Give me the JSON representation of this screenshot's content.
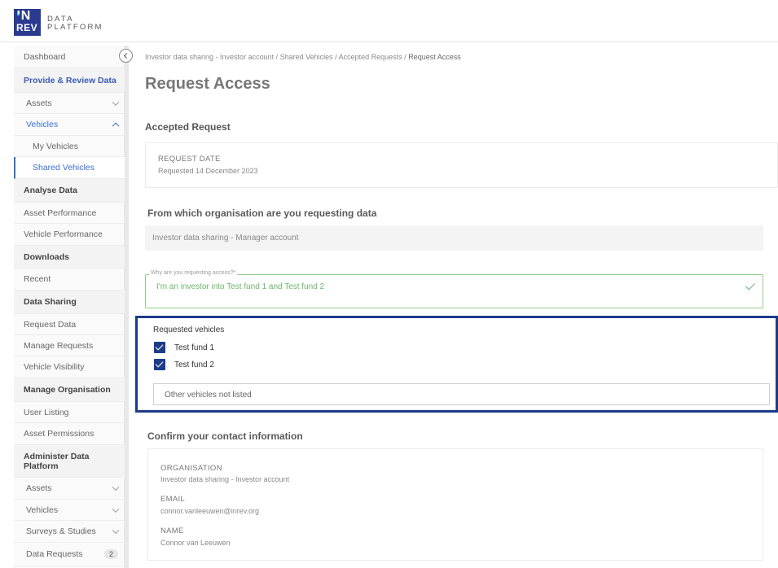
{
  "header": {
    "logo_line1": "'N",
    "logo_line2": "REV",
    "logo_text_line1": "DATA",
    "logo_text_line2": "PLATFORM"
  },
  "sidebar": {
    "items": [
      {
        "label": "Dashboard"
      },
      {
        "label": "Provide & Review Data"
      },
      {
        "label": "Assets"
      },
      {
        "label": "Vehicles"
      },
      {
        "label": "My Vehicles"
      },
      {
        "label": "Shared Vehicles"
      },
      {
        "label": "Analyse Data"
      },
      {
        "label": "Asset Performance"
      },
      {
        "label": "Vehicle Performance"
      },
      {
        "label": "Downloads"
      },
      {
        "label": "Recent"
      },
      {
        "label": "Data Sharing"
      },
      {
        "label": "Request Data"
      },
      {
        "label": "Manage Requests"
      },
      {
        "label": "Vehicle Visibility"
      },
      {
        "label": "Manage Organisation"
      },
      {
        "label": "User Listing"
      },
      {
        "label": "Asset Permissions"
      },
      {
        "label": "Administer Data Platform"
      },
      {
        "label": "Assets"
      },
      {
        "label": "Vehicles"
      },
      {
        "label": "Surveys & Studies"
      },
      {
        "label": "Data Requests",
        "badge": "2"
      }
    ]
  },
  "breadcrumb": {
    "path": "Investor data sharing - Investor account / Shared Vehicles / Accepted Requests / ",
    "current": "Request Access"
  },
  "page": {
    "title": "Request Access"
  },
  "accepted_request": {
    "title": "Accepted Request",
    "date_label": "REQUEST DATE",
    "date_value": "Requested 14 December 2023"
  },
  "organisation": {
    "title": "From which organisation are you requesting data",
    "value": "Investor data sharing - Manager account"
  },
  "reason": {
    "label": "Why are you requesting access?*",
    "value": "I'm an investor into Test fund 1 and Test fund 2"
  },
  "requested_vehicles": {
    "title": "Requested vehicles",
    "options": [
      {
        "label": "Test fund 1",
        "checked": true
      },
      {
        "label": "Test fund 2",
        "checked": true
      }
    ],
    "other_placeholder": "Other vehicles not listed"
  },
  "contact": {
    "title": "Confirm your contact information",
    "org_label": "ORGANISATION",
    "org_value": "Investor data sharing - Investor account",
    "email_label": "EMAIL",
    "email_value": "connor.vanleeuwen@inrev.org",
    "name_label": "NAME",
    "name_value": "Connor van Leeuwen"
  },
  "colors": {
    "brand": "#2b3b8f",
    "highlight_border": "#1c3c8a",
    "success": "#6bb86a",
    "link": "#3a6fd0"
  }
}
